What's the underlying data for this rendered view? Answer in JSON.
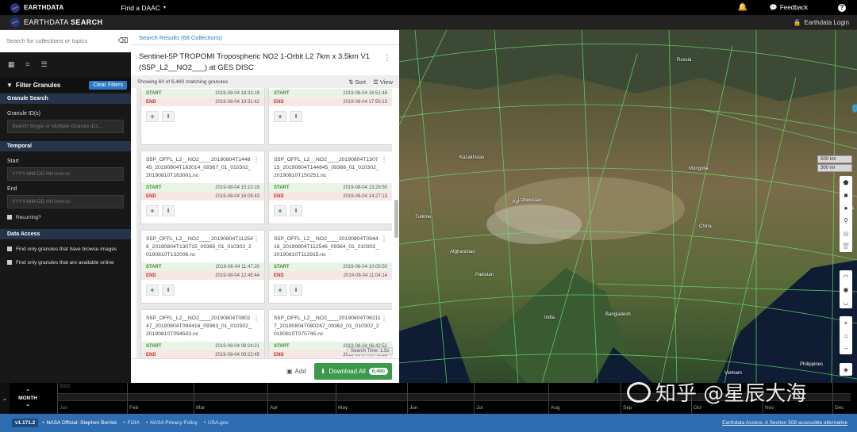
{
  "topbar": {
    "brand": "EARTHDATA",
    "find_daac": "Find a DAAC",
    "feedback": "Feedback"
  },
  "secondbar": {
    "brand_light": "EARTHDATA ",
    "brand_bold": "SEARCH",
    "login": "Earthdata Login"
  },
  "sidebar": {
    "search_placeholder": "Search for collections or topics",
    "filter_title": "Filter Granules",
    "clear_filters": "Clear Filters",
    "granule_search": "Granule Search",
    "granule_ids_label": "Granule ID(s)",
    "granule_ids_placeholder": "Search Single or Multiple Granule IDs...",
    "temporal": "Temporal",
    "start_label": "Start",
    "start_placeholder": "YYYY-MM-DD HH:mm:ss",
    "end_label": "End",
    "end_placeholder": "YYYY-MM-DD HH:mm:ss",
    "recurring": "Recurring?",
    "data_access": "Data Access",
    "browse_images": "Find only granules that have browse images",
    "available_online": "Find only granules that are available online"
  },
  "panel": {
    "search_results": "Search Results (68 Collections)",
    "collection_title": "Sentinel-5P TROPOMI Tropospheric NO2 1-Orbit L2 7km x 3.5km V1 (S5P_L2__NO2___) at GES DISC",
    "showing": "Showing 60 of 6,480 matching granules",
    "sort": "Sort",
    "view": "View",
    "search_time": "Search Time: 1.5s",
    "add": "Add",
    "download_all": "Download All",
    "download_count": "6,480",
    "start_label": "START",
    "end_label": "END"
  },
  "granules": [
    {
      "name": "",
      "start": "2019-08-04 18:33:19",
      "end": "2019-08-04 19:31:42"
    },
    {
      "name": "",
      "start": "2019-08-04 16:51:48",
      "end": "2019-08-04 17:50:13"
    },
    {
      "name": "S5P_OFFL_L2__NO2____20190804T144845_20190804T163014_09367_01_010302_20190810T163001.nc",
      "start": "2019-08-04 15:10:19",
      "end": "2019-08-04 16:08:43"
    },
    {
      "name": "S5P_OFFL_L2__NO2____20190804T130715_20190804T144845_09366_01_010302_20190810T150251.nc",
      "start": "2019-08-04 13:28:50",
      "end": "2019-08-04 14:27:13"
    },
    {
      "name": "S5P_OFFL_L2__NO2____20190804T112546_20190804T130715_09365_01_010302_20190810T132006.nc",
      "start": "2019-08-04 11:47:20",
      "end": "2019-08-04 12:45:44"
    },
    {
      "name": "S5P_OFFL_L2__NO2____20190804T094416_20190804T112546_09364_01_010302_20190810T112915.nc",
      "start": "2019-08-04 10:05:50",
      "end": "2019-08-04 11:04:14"
    },
    {
      "name": "S5P_OFFL_L2__NO2____20190804T080247_20190804T094416_09363_01_010302_20190810T094503.nc",
      "start": "2019-08-04 08:24:21",
      "end": "2019-08-04 09:22:45"
    },
    {
      "name": "S5P_OFFL_L2__NO2____20190804T062117_20190804T080247_09362_01_010302_20190810T075745.nc",
      "start": "2019-08-04 06:42:52",
      "end": "2019-08-04 07:41:15"
    }
  ],
  "map": {
    "labels": [
      "Russia",
      "Kazakhstan",
      "Mongolia",
      "Uzbekistan",
      "Turkme",
      "Kyr",
      "Afghanistan",
      "China",
      "Pakistan",
      "India",
      "Bangladesh",
      "Vietnam",
      "Philippines",
      "South",
      "Japa"
    ],
    "scale_km": "500 km",
    "scale_mi": "300 mi"
  },
  "timeline": {
    "zoom_label": "MONTH",
    "year": "2022",
    "months": [
      "Jan",
      "Feb",
      "Mar",
      "Apr",
      "May",
      "Jun",
      "Jul",
      "Aug",
      "Sep",
      "Oct",
      "Nov",
      "Dec"
    ]
  },
  "status": {
    "version": "v1.171.2",
    "official": "NASA Official: Stephen Berrick",
    "foia": "FOIA",
    "privacy": "NASA Privacy Policy",
    "usa": "USA.gov",
    "access": "Earthdata Access: A Section 508 accessible alternative"
  },
  "watermark": "知乎 @星辰大海"
}
